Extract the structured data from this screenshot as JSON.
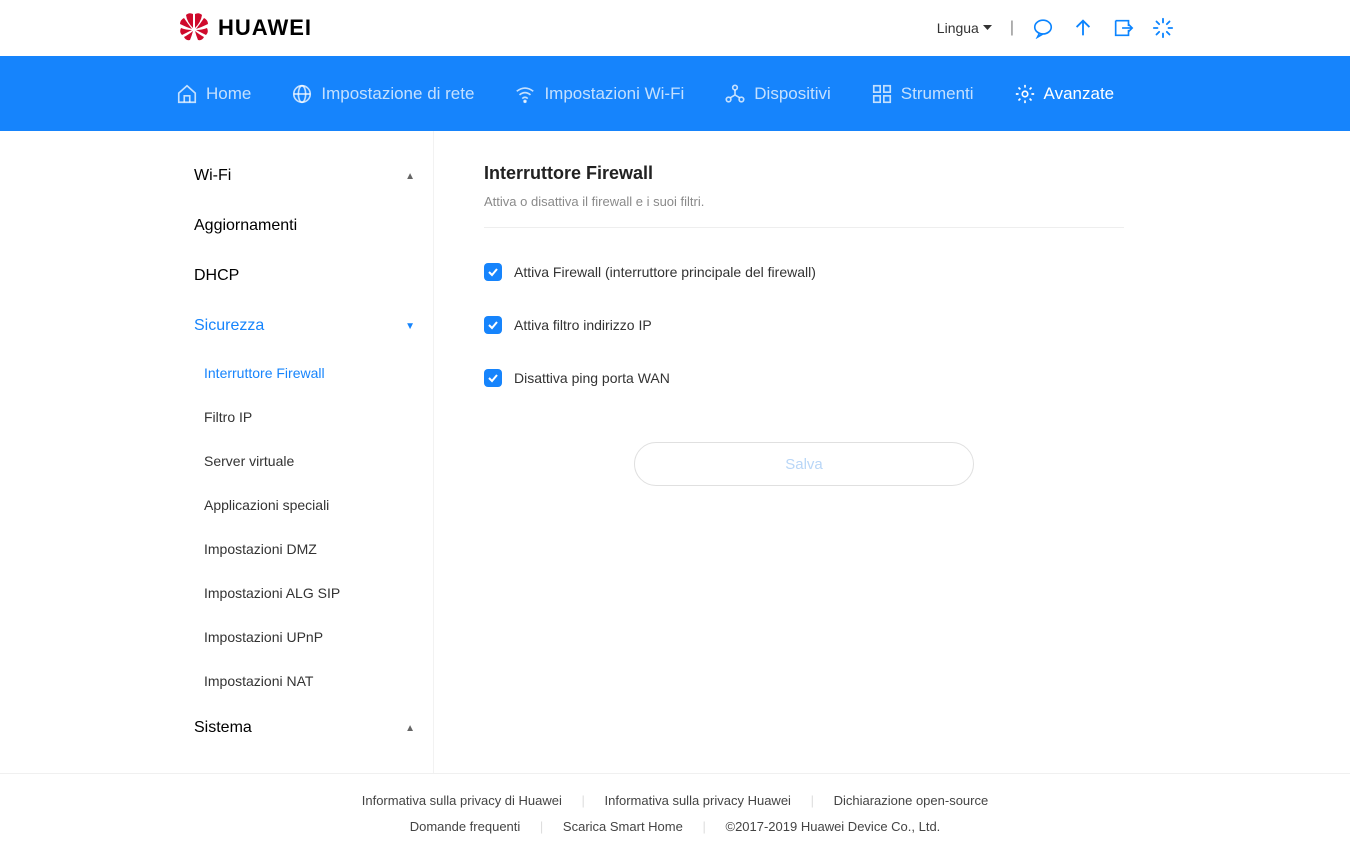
{
  "header": {
    "brand": "HUAWEI",
    "lang_label": "Lingua"
  },
  "nav": {
    "home": "Home",
    "network": "Impostazione di rete",
    "wifi": "Impostazioni Wi-Fi",
    "devices": "Dispositivi",
    "tools": "Strumenti",
    "advanced": "Avanzate"
  },
  "sidebar": {
    "wifi": "Wi-Fi",
    "updates": "Aggiornamenti",
    "dhcp": "DHCP",
    "security": "Sicurezza",
    "security_items": {
      "firewall": "Interruttore Firewall",
      "ipfilter": "Filtro IP",
      "vserver": "Server virtuale",
      "special": "Applicazioni speciali",
      "dmz": "Impostazioni DMZ",
      "alg": "Impostazioni ALG SIP",
      "upnp": "Impostazioni UPnP",
      "nat": "Impostazioni NAT"
    },
    "system": "Sistema"
  },
  "main": {
    "title": "Interruttore Firewall",
    "desc": "Attiva o disattiva il firewall e i suoi filtri.",
    "check1": "Attiva Firewall (interruttore principale del firewall)",
    "check2": "Attiva filtro indirizzo IP",
    "check3": "Disattiva ping porta WAN",
    "save": "Salva"
  },
  "footer": {
    "link1": "Informativa sulla privacy di Huawei",
    "link2": "Informativa sulla privacy Huawei",
    "link3": "Dichiarazione open-source",
    "link4": "Domande frequenti",
    "link5": "Scarica Smart Home",
    "copyright": "©2017-2019 Huawei Device Co., Ltd."
  }
}
